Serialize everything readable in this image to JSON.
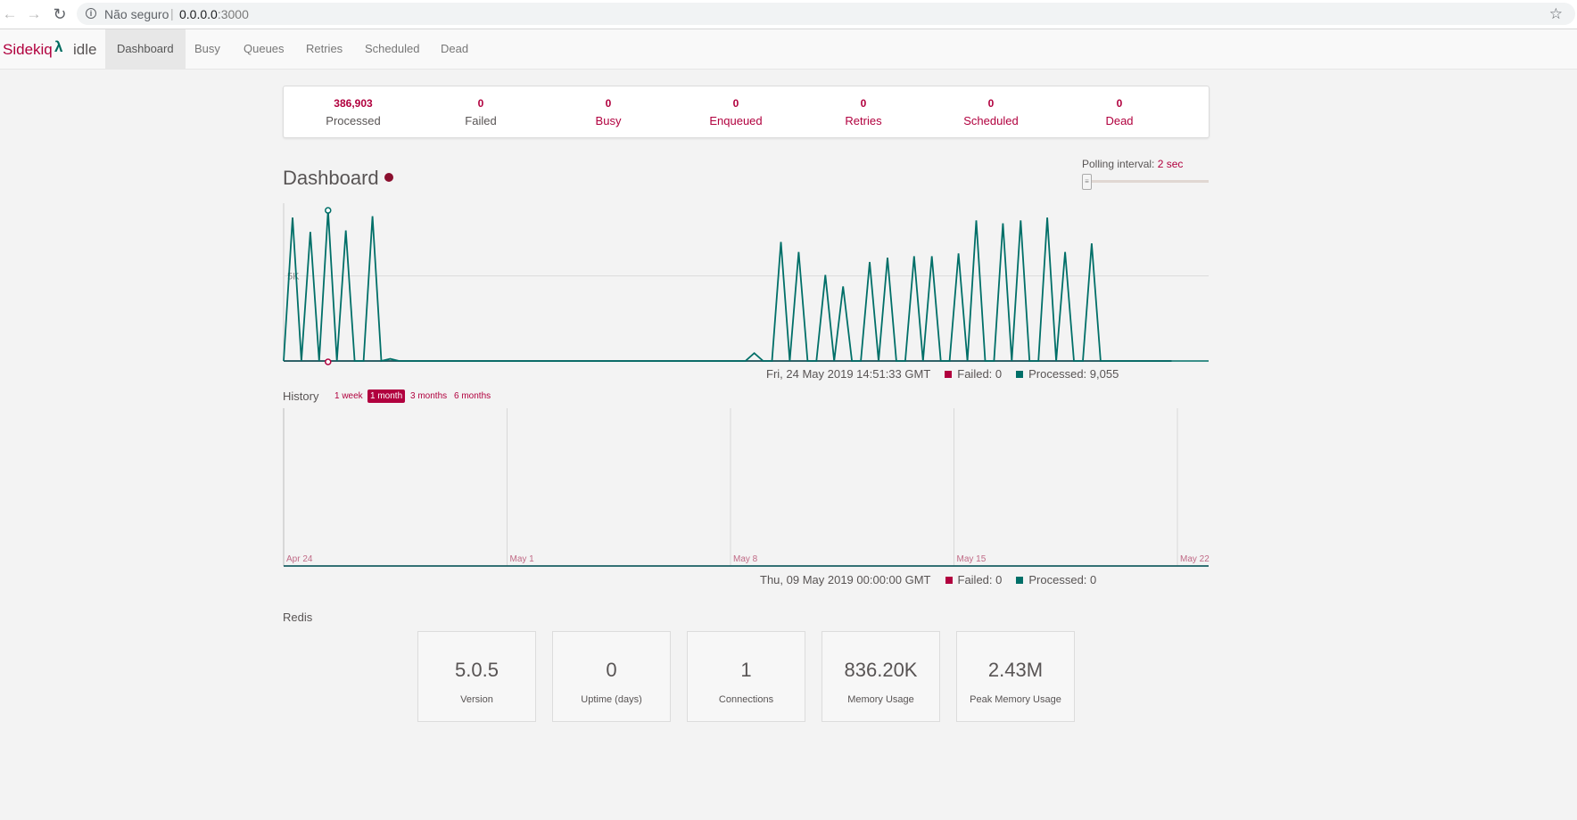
{
  "browser": {
    "security_label": "Não seguro",
    "url_host": "0.0.0.0",
    "url_port": ":3000"
  },
  "app": {
    "brand": "Sidekiq",
    "status": "idle",
    "tabs": [
      {
        "label": "Dashboard",
        "active": true
      },
      {
        "label": "Busy"
      },
      {
        "label": "Queues"
      },
      {
        "label": "Retries"
      },
      {
        "label": "Scheduled"
      },
      {
        "label": "Dead"
      }
    ]
  },
  "summary": [
    {
      "value": "386,903",
      "label": "Processed"
    },
    {
      "value": "0",
      "label": "Failed"
    },
    {
      "value": "0",
      "label": "Busy"
    },
    {
      "value": "0",
      "label": "Enqueued"
    },
    {
      "value": "0",
      "label": "Retries"
    },
    {
      "value": "0",
      "label": "Scheduled"
    },
    {
      "value": "0",
      "label": "Dead"
    }
  ],
  "dashboard": {
    "title": "Dashboard",
    "polling_label": "Polling interval:",
    "polling_value": "2 sec"
  },
  "realtime": {
    "timestamp": "Fri, 24 May 2019 14:51:33 GMT",
    "failed_legend": "Failed: 0",
    "processed_legend": "Processed: 9,055"
  },
  "history": {
    "label": "History",
    "ranges": [
      {
        "label": "1 week"
      },
      {
        "label": "1 month",
        "active": true
      },
      {
        "label": "3 months"
      },
      {
        "label": "6 months"
      }
    ],
    "timestamp": "Thu, 09 May 2019 00:00:00 GMT",
    "failed_legend": "Failed: 0",
    "processed_legend": "Processed: 0"
  },
  "redis": {
    "label": "Redis",
    "cards": [
      {
        "value": "5.0.5",
        "label": "Version"
      },
      {
        "value": "0",
        "label": "Uptime (days)"
      },
      {
        "value": "1",
        "label": "Connections"
      },
      {
        "value": "836.20K",
        "label": "Memory Usage"
      },
      {
        "value": "2.43M",
        "label": "Peak Memory Usage"
      }
    ]
  },
  "chart_data": [
    {
      "type": "line",
      "title": "",
      "ytick_labels": [
        "5K"
      ],
      "ylim": [
        0,
        11000
      ],
      "grid": true,
      "series": [
        {
          "name": "Failed",
          "color": "#b1003e",
          "values": [
            0,
            0,
            0,
            0,
            0,
            0,
            0,
            0,
            0,
            0,
            0,
            0,
            0,
            0,
            0,
            0,
            0,
            0,
            0,
            0,
            0,
            0,
            0,
            0,
            0,
            0,
            0,
            0,
            0,
            0,
            0,
            0,
            0,
            0,
            0,
            0,
            0,
            0,
            0,
            0,
            0,
            0,
            0,
            0,
            0,
            0,
            0,
            0,
            0,
            0,
            0,
            0,
            0,
            0,
            0,
            0,
            0,
            0,
            0,
            0,
            0,
            0,
            0,
            0,
            0,
            0,
            0,
            0,
            0,
            0,
            0,
            0,
            0,
            0,
            0,
            0,
            0,
            0,
            0,
            0,
            0,
            0,
            0,
            0,
            0,
            0,
            0,
            0,
            0,
            0,
            0,
            0,
            0,
            0,
            0,
            0,
            0,
            0,
            0,
            0,
            0
          ]
        },
        {
          "name": "Processed",
          "color": "#006f68",
          "values": [
            0,
            10000,
            0,
            9000,
            0,
            10500,
            0,
            9100,
            0,
            0,
            10100,
            0,
            150,
            0,
            0,
            0,
            0,
            0,
            0,
            0,
            0,
            0,
            0,
            0,
            0,
            0,
            0,
            0,
            0,
            0,
            0,
            0,
            0,
            0,
            0,
            0,
            0,
            0,
            0,
            0,
            0,
            0,
            0,
            0,
            0,
            0,
            0,
            0,
            0,
            0,
            0,
            0,
            0,
            550,
            0,
            0,
            8300,
            0,
            7600,
            0,
            0,
            6000,
            0,
            5200,
            0,
            0,
            6900,
            0,
            7200,
            0,
            0,
            7300,
            0,
            7300,
            0,
            0,
            7500,
            0,
            9800,
            0,
            0,
            9600,
            0,
            9800,
            0,
            0,
            10000,
            0,
            7600,
            0,
            0,
            8200,
            0,
            0,
            0,
            0,
            0,
            0,
            0,
            0,
            0
          ]
        }
      ],
      "highlight": {
        "processed": 9055,
        "failed": 0
      }
    },
    {
      "type": "line",
      "title": "",
      "x_tick_labels": [
        "Apr 24",
        "May 1",
        "May 8",
        "May 15",
        "May 22"
      ],
      "series": [
        {
          "name": "Failed",
          "color": "#b1003e",
          "values": [
            0,
            0,
            0,
            0,
            0,
            0,
            0,
            0,
            0,
            0,
            0,
            0,
            0,
            0,
            0,
            0,
            0,
            0,
            0,
            0,
            0,
            0,
            0,
            0,
            0,
            0,
            0,
            0,
            0,
            0
          ]
        },
        {
          "name": "Processed",
          "color": "#006f68",
          "values": [
            0,
            0,
            0,
            0,
            0,
            0,
            0,
            0,
            0,
            0,
            0,
            0,
            0,
            0,
            0,
            0,
            0,
            0,
            0,
            0,
            0,
            0,
            0,
            0,
            0,
            0,
            0,
            0,
            0,
            0
          ]
        }
      ],
      "grid": true
    }
  ]
}
